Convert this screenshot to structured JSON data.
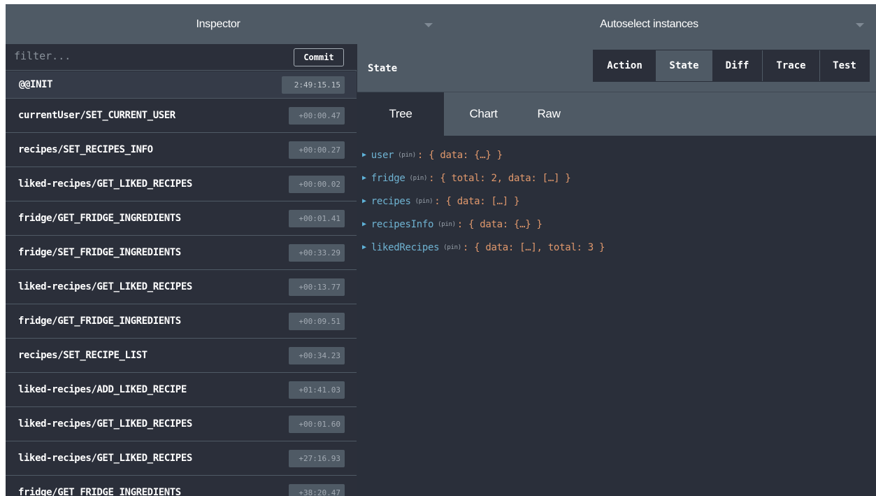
{
  "topbar": {
    "inspector_label": "Inspector",
    "instances_label": "Autoselect instances",
    "inspector_caret": "chevron-down-icon",
    "instances_caret": "chevron-down-icon"
  },
  "sidebar": {
    "filter_placeholder": "filter...",
    "filter_value": "",
    "commit_label": "Commit",
    "actions": [
      {
        "name": "@@INIT",
        "time": "2:49:15.15"
      },
      {
        "name": "currentUser/SET_CURRENT_USER",
        "time": "+00:00.47"
      },
      {
        "name": "recipes/SET_RECIPES_INFO",
        "time": "+00:00.27"
      },
      {
        "name": "liked-recipes/GET_LIKED_RECIPES",
        "time": "+00:00.02"
      },
      {
        "name": "fridge/GET_FRIDGE_INGREDIENTS",
        "time": "+00:01.41"
      },
      {
        "name": "fridge/SET_FRIDGE_INGREDIENTS",
        "time": "+00:33.29"
      },
      {
        "name": "liked-recipes/GET_LIKED_RECIPES",
        "time": "+00:13.77"
      },
      {
        "name": "fridge/GET_FRIDGE_INGREDIENTS",
        "time": "+00:09.51"
      },
      {
        "name": "recipes/SET_RECIPE_LIST",
        "time": "+00:34.23"
      },
      {
        "name": "liked-recipes/ADD_LIKED_RECIPE",
        "time": "+01:41.03"
      },
      {
        "name": "liked-recipes/GET_LIKED_RECIPES",
        "time": "+00:01.60"
      },
      {
        "name": "liked-recipes/GET_LIKED_RECIPES",
        "time": "+27:16.93"
      },
      {
        "name": "fridge/GET_FRIDGE_INGREDIENTS",
        "time": "+38:20.47"
      }
    ]
  },
  "main": {
    "title": "State",
    "monitor_tabs": [
      {
        "label": "Action",
        "active": false
      },
      {
        "label": "State",
        "active": true
      },
      {
        "label": "Diff",
        "active": false
      },
      {
        "label": "Trace",
        "active": false
      },
      {
        "label": "Test",
        "active": false
      }
    ],
    "sub_tabs": [
      {
        "label": "Tree",
        "active": true
      },
      {
        "label": "Chart",
        "active": false
      },
      {
        "label": "Raw",
        "active": false
      }
    ],
    "tree": [
      {
        "key": "user",
        "pin": "(pin)",
        "value": ": { data: {…} }"
      },
      {
        "key": "fridge",
        "pin": "(pin)",
        "value": ": { total: 2, data: […] }"
      },
      {
        "key": "recipes",
        "pin": "(pin)",
        "value": ": { data: […] }"
      },
      {
        "key": "recipesInfo",
        "pin": "(pin)",
        "value": ": { data: {…} }"
      },
      {
        "key": "likedRecipes",
        "pin": "(pin)",
        "value": ": { data: […], total: 3 }"
      }
    ],
    "tree_arrow_icon": "triangle-right-icon"
  },
  "colors": {
    "header_bg": "#4f5a65",
    "panel_bg": "#2b2f3a",
    "tree_key": "#6fb3d2",
    "tree_value": "#e0986c"
  }
}
